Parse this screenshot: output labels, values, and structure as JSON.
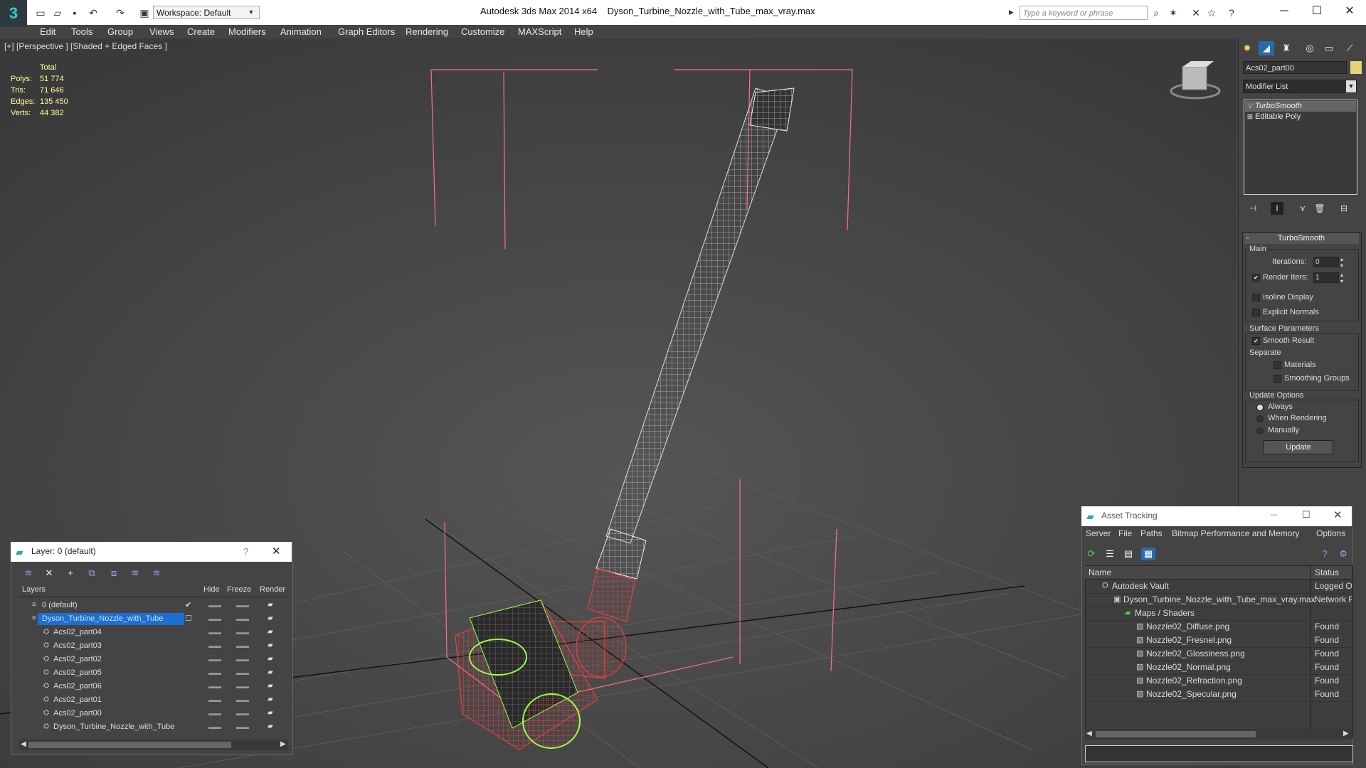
{
  "titlebar": {
    "logo_text": "3",
    "workspace": "Workspace: Default",
    "app_title": "Autodesk 3ds Max  2014 x64",
    "file_title": "Dyson_Turbine_Nozzle_with_Tube_max_vray.max",
    "search_placeholder": "Type a keyword or phrase",
    "minimize": "─",
    "maximize": "☐",
    "close": "✕"
  },
  "menu": [
    "Edit",
    "Tools",
    "Group",
    "Views",
    "Create",
    "Modifiers",
    "Animation",
    "Graph Editors",
    "Rendering",
    "Customize",
    "MAXScript",
    "Help"
  ],
  "viewport": {
    "label": "[+] [Perspective ] [Shaded + Edged Faces ]",
    "stats": {
      "header": "Total",
      "polys_label": "Polys:",
      "polys": "51 774",
      "tris_label": "Tris:",
      "tris": "71 646",
      "edges_label": "Edges:",
      "edges": "135 450",
      "verts_label": "Verts:",
      "verts": "44 382"
    }
  },
  "command_panel": {
    "object_name": "Acs02_part00",
    "object_color": "#e8d27a",
    "modifier_list": "Modifier List",
    "stack": [
      "TurboSmooth",
      "Editable Poly"
    ],
    "rollout": {
      "title": "TurboSmooth",
      "main": "Main",
      "iterations_label": "Iterations:",
      "iterations": "0",
      "render_iters_label": "Render Iters:",
      "render_iters": "1",
      "isoline": "Isoline Display",
      "explicit_normals": "Explicit Normals",
      "surface_params": "Surface Parameters",
      "smooth_result": "Smooth Result",
      "separate": "Separate",
      "materials": "Materials",
      "smoothing_groups": "Smoothing Groups",
      "update_options": "Update Options",
      "always": "Always",
      "when_rendering": "When Rendering",
      "manually": "Manually",
      "update_btn": "Update"
    }
  },
  "layer_dialog": {
    "title": "Layer: 0 (default)",
    "help": "?",
    "close": "✕",
    "columns": {
      "layers": "Layers",
      "hide": "Hide",
      "freeze": "Freeze",
      "render": "Render"
    },
    "rows": [
      {
        "name": "0 (default)",
        "indent": 0,
        "selected": false
      },
      {
        "name": "Dyson_Turbine_Nozzle_with_Tube",
        "indent": 0,
        "selected": true
      },
      {
        "name": "Acs02_part04",
        "indent": 1,
        "selected": false
      },
      {
        "name": "Acs02_part03",
        "indent": 1,
        "selected": false
      },
      {
        "name": "Acs02_part02",
        "indent": 1,
        "selected": false
      },
      {
        "name": "Acs02_part05",
        "indent": 1,
        "selected": false
      },
      {
        "name": "Acs02_part06",
        "indent": 1,
        "selected": false
      },
      {
        "name": "Acs02_part01",
        "indent": 1,
        "selected": false
      },
      {
        "name": "Acs02_part00",
        "indent": 1,
        "selected": false
      },
      {
        "name": "Dyson_Turbine_Nozzle_with_Tube",
        "indent": 1,
        "selected": false
      }
    ]
  },
  "asset_dialog": {
    "title": "Asset Tracking",
    "menu": [
      "Server",
      "File",
      "Paths",
      "Bitmap Performance and Memory",
      "Options"
    ],
    "columns": {
      "name": "Name",
      "status": "Status"
    },
    "rows": [
      {
        "name": "Autodesk Vault",
        "indent": 1,
        "status": "Logged O"
      },
      {
        "name": "Dyson_Turbine_Nozzle_with_Tube_max_vray.max",
        "indent": 2,
        "status": "Network P"
      },
      {
        "name": "Maps / Shaders",
        "indent": 3,
        "status": ""
      },
      {
        "name": "Nozzle02_Diffuse.png",
        "indent": 4,
        "status": "Found"
      },
      {
        "name": "Nozzle02_Fresnel.png",
        "indent": 4,
        "status": "Found"
      },
      {
        "name": "Nozzle02_Glossiness.png",
        "indent": 4,
        "status": "Found"
      },
      {
        "name": "Nozzle02_Normal.png",
        "indent": 4,
        "status": "Found"
      },
      {
        "name": "Nozzle02_Refraction.png",
        "indent": 4,
        "status": "Found"
      },
      {
        "name": "Nozzle02_Specular.png",
        "indent": 4,
        "status": "Found"
      }
    ]
  }
}
